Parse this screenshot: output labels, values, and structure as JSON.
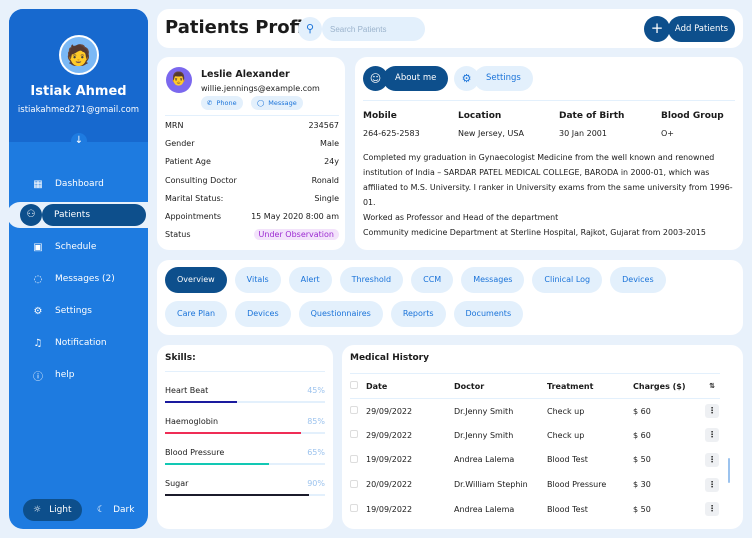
{
  "user": {
    "name": "Istiak Ahmed",
    "email": "istiakahmed271@gmail.com"
  },
  "nav": [
    {
      "label": "Dashboard",
      "icon": "dashboard-icon"
    },
    {
      "label": "Patients",
      "icon": "patients-icon"
    },
    {
      "label": "Schedule",
      "icon": "calendar-icon"
    },
    {
      "label": "Messages (2)",
      "icon": "message-icon"
    },
    {
      "label": "Settings",
      "icon": "gear-icon"
    },
    {
      "label": "Notification",
      "icon": "bell-icon"
    },
    {
      "label": "help",
      "icon": "help-icon"
    }
  ],
  "mode": {
    "light": "Light",
    "dark": "Dark"
  },
  "header": {
    "title": "Patients Profile",
    "search_placeholder": "Search Patients",
    "add_label": "Add Patients"
  },
  "patient": {
    "name": "Leslie Alexander",
    "email": "willie.jennings@example.com",
    "phone_label": "Phone",
    "message_label": "Message",
    "info": [
      {
        "k": "MRN",
        "v": "234567"
      },
      {
        "k": "Gender",
        "v": "Male"
      },
      {
        "k": "Patient Age",
        "v": "24y"
      },
      {
        "k": "Consulting Doctor",
        "v": "Ronald"
      },
      {
        "k": "Marital Status:",
        "v": "Single"
      },
      {
        "k": "Appointments",
        "v": "15 May 2020 8:00 am"
      },
      {
        "k": "Status",
        "v": "Under Observation"
      }
    ]
  },
  "about": {
    "about_label": "About me",
    "settings_label": "Settings",
    "fields": [
      {
        "k": "Mobile",
        "v": "264-625-2583"
      },
      {
        "k": "Location",
        "v": "New Jersey, USA"
      },
      {
        "k": "Date of Birth",
        "v": "30 Jan 2001"
      },
      {
        "k": "Blood Group",
        "v": "O+"
      }
    ],
    "bio": [
      "Completed my graduation in Gynaecologist Medicine from the well known and renowned institution of India – SARDAR PATEL MEDICAL COLLEGE, BARODA in 2000-01, which was affiliated to M.S. University. I ranker in University exams from the same university from 1996-01.",
      "Worked as Professor and Head of the department",
      "Community medicine Department at Sterline Hospital, Rajkot, Gujarat from 2003-2015"
    ]
  },
  "tabs": [
    "Overview",
    "Vitals",
    "Alert",
    "Threshold",
    "CCM",
    "Messages",
    "Clinical Log",
    "Devices",
    "Care Plan",
    "Devices",
    "Questionnaires",
    "Reports",
    "Documents"
  ],
  "skills": {
    "title": "Skills:",
    "items": [
      {
        "label": "Heart Beat",
        "pct": "45%",
        "value": 45,
        "color": "#1a1a9e"
      },
      {
        "label": "Haemoglobin",
        "pct": "85%",
        "value": 85,
        "color": "#ef2d56"
      },
      {
        "label": "Blood Pressure",
        "pct": "65%",
        "value": 65,
        "color": "#12c8b4"
      },
      {
        "label": "Sugar",
        "pct": "90%",
        "value": 90,
        "color": "#1b1b2b"
      }
    ]
  },
  "history": {
    "title": "Medical History",
    "columns": [
      "Date",
      "Doctor",
      "Treatment",
      "Charges ($)"
    ],
    "rows": [
      [
        "29/09/2022",
        "Dr.Jenny Smith",
        "Check up",
        "$ 60"
      ],
      [
        "29/09/2022",
        "Dr.Jenny Smith",
        "Check up",
        "$ 60"
      ],
      [
        "19/09/2022",
        "Andrea Lalema",
        "Blood Test",
        "$ 50"
      ],
      [
        "20/09/2022",
        "Dr.William Stephin",
        "Blood Pressure",
        "$ 30"
      ],
      [
        "19/09/2022",
        "Andrea Lalema",
        "Blood Test",
        "$ 50"
      ]
    ]
  }
}
